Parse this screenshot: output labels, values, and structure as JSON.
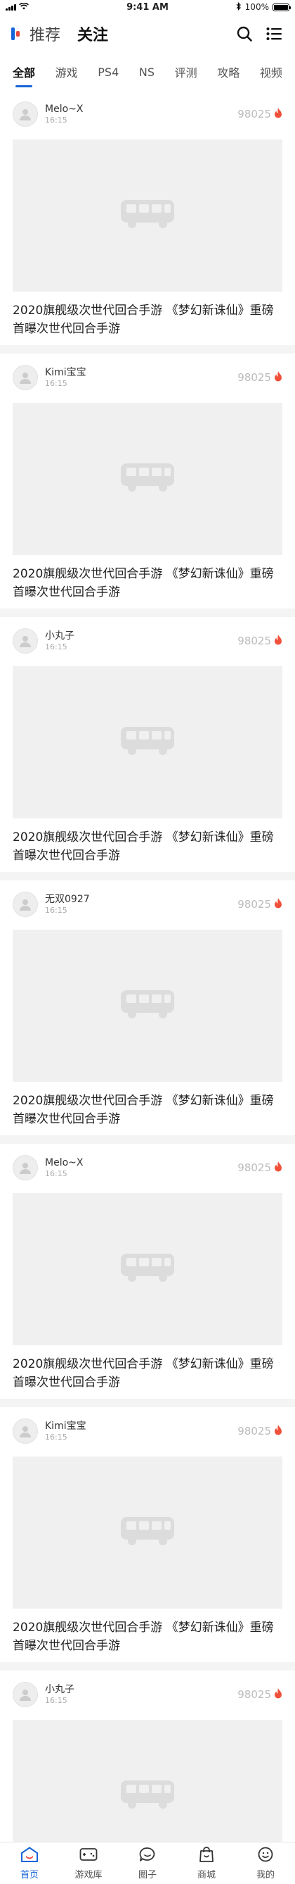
{
  "status_bar": {
    "time": "9:41 AM",
    "battery": "100%"
  },
  "header": {
    "tabs": [
      "推荐",
      "关注"
    ],
    "active_tab": 1
  },
  "categories": {
    "items": [
      "全部",
      "游戏",
      "PS4",
      "NS",
      "评测",
      "攻略",
      "视频"
    ],
    "active": 0
  },
  "feed": {
    "posts": [
      {
        "user": "Melo~X",
        "time": "16:15",
        "heat": "98025",
        "title": "2020旗舰级次世代回合手游 《梦幻新诛仙》重磅首曝次世代回合手游"
      },
      {
        "user": "Kimi宝宝",
        "time": "16:15",
        "heat": "98025",
        "title": "2020旗舰级次世代回合手游 《梦幻新诛仙》重磅首曝次世代回合手游"
      },
      {
        "user": "小丸子",
        "time": "16:15",
        "heat": "98025",
        "title": "2020旗舰级次世代回合手游 《梦幻新诛仙》重磅首曝次世代回合手游"
      },
      {
        "user": "无双0927",
        "time": "16:15",
        "heat": "98025",
        "title": "2020旗舰级次世代回合手游 《梦幻新诛仙》重磅首曝次世代回合手游"
      },
      {
        "user": "Melo~X",
        "time": "16:15",
        "heat": "98025",
        "title": "2020旗舰级次世代回合手游 《梦幻新诛仙》重磅首曝次世代回合手游"
      },
      {
        "user": "Kimi宝宝",
        "time": "16:15",
        "heat": "98025",
        "title": "2020旗舰级次世代回合手游 《梦幻新诛仙》重磅首曝次世代回合手游"
      },
      {
        "user": "小丸子",
        "time": "16:15",
        "heat": "98025",
        "title": ""
      }
    ]
  },
  "tab_bar": {
    "items": [
      {
        "label": "首页",
        "icon": "home-icon"
      },
      {
        "label": "游戏库",
        "icon": "gamepad-icon"
      },
      {
        "label": "圈子",
        "icon": "chat-icon"
      },
      {
        "label": "商城",
        "icon": "shopping-bag-icon"
      },
      {
        "label": "我的",
        "icon": "profile-icon"
      }
    ],
    "active": 0
  },
  "colors": {
    "accent": "#1565d8",
    "brand_red": "#e8463a",
    "fire": "#f0503a"
  }
}
